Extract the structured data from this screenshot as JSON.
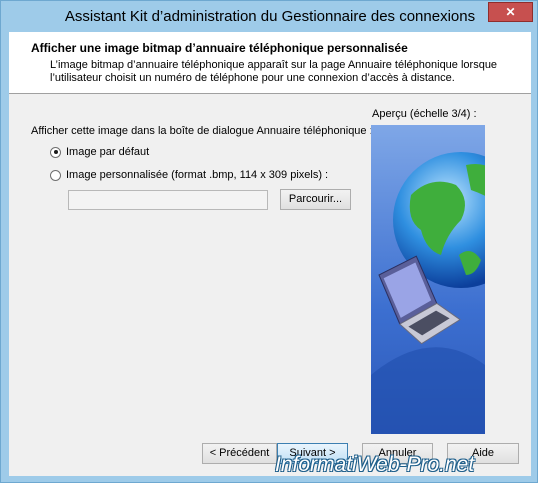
{
  "window": {
    "title": "Assistant Kit d’administration du Gestionnaire des connexions",
    "close_glyph": "✕"
  },
  "header": {
    "title": "Afficher une image bitmap d’annuaire téléphonique personnalisée",
    "description": "L’image bitmap d’annuaire téléphonique apparaît sur la page Annuaire téléphonique lorsque l’utilisateur choisit un numéro de téléphone pour une connexion d’accès à distance."
  },
  "body": {
    "prompt": "Afficher cette image dans la boîte de dialogue Annuaire téléphonique :",
    "options": [
      {
        "label": "Image par défaut",
        "checked": true
      },
      {
        "label": "Image personnalisée (format .bmp, 114 x 309 pixels) :",
        "checked": false
      }
    ],
    "path_value": "",
    "browse_label": "Parcourir...",
    "preview_label": "Aperçu (échelle 3/4) :"
  },
  "buttons": {
    "previous": "< Précédent",
    "next": "Suivant >",
    "cancel": "Annuler",
    "help": "Aide"
  },
  "watermark": "InformatiWeb-Pro.net"
}
